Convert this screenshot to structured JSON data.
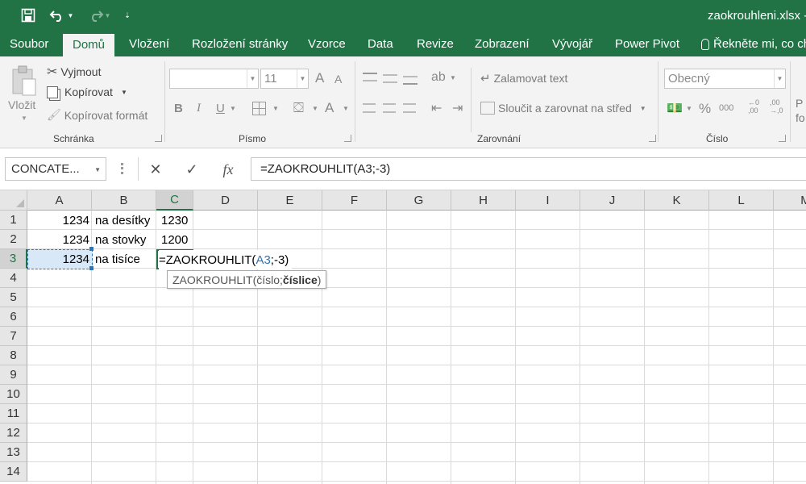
{
  "window": {
    "title": "zaokrouhleni.xlsx -"
  },
  "qat": {
    "save_icon": "save-icon",
    "undo_icon": "undo-icon",
    "redo_icon": "redo-icon",
    "customize_icon": "chevron-down-icon"
  },
  "tabs": [
    {
      "label": "Soubor"
    },
    {
      "label": "Domů"
    },
    {
      "label": "Vložení"
    },
    {
      "label": "Rozložení stránky"
    },
    {
      "label": "Vzorce"
    },
    {
      "label": "Data"
    },
    {
      "label": "Revize"
    },
    {
      "label": "Zobrazení"
    },
    {
      "label": "Vývojář"
    },
    {
      "label": "Power Pivot"
    },
    {
      "label": "Řekněte mi, co ch"
    }
  ],
  "ribbon": {
    "clipboard": {
      "paste": "Vložit",
      "cut": "Vyjmout",
      "copy": "Kopírovat",
      "format_painter": "Kopírovat formát",
      "group": "Schránka"
    },
    "font": {
      "font_name": "",
      "font_size": "11",
      "group": "Písmo",
      "bold": "B",
      "italic": "I",
      "underline": "U",
      "grow": "A",
      "shrink": "A",
      "font_color": "A"
    },
    "alignment": {
      "wrap": "Zalamovat text",
      "merge": "Sloučit a zarovnat na střed",
      "group": "Zarovnání"
    },
    "number": {
      "format": "Obecný",
      "percent": "%",
      "thousands": "000",
      "group": "Číslo",
      "inc_decimal": "←0 ,00",
      "dec_decimal": ",00 →,0"
    },
    "cut_right": {
      "line1": "P",
      "line2": "fo"
    }
  },
  "formula_bar": {
    "name_box": "CONCATE...",
    "cancel": "✕",
    "enter": "✓",
    "fx": "fx",
    "formula": "=ZAOKROUHLIT(A3;-3)"
  },
  "columns": [
    "A",
    "B",
    "C",
    "D",
    "E",
    "F",
    "G",
    "H",
    "I",
    "J",
    "K",
    "L",
    "M"
  ],
  "rows": [
    "1",
    "2",
    "3",
    "4",
    "5",
    "6",
    "7",
    "8",
    "9",
    "10",
    "11",
    "12",
    "13",
    "14"
  ],
  "cells": {
    "A1": "1234",
    "B1": "na desítky",
    "C1": "1230",
    "A2": "1234",
    "B2": "na stovky",
    "C2": "1200",
    "A3": "1234",
    "B3": "na tisíce"
  },
  "edit": {
    "prefix": "=ZAOKROUHLIT(",
    "ref": "A3",
    "suffix": ";-3)"
  },
  "tooltip": {
    "func": "ZAOKROUHLIT(",
    "arg1": "číslo; ",
    "arg2": "číslice",
    "close": ")"
  },
  "colors": {
    "accent": "#217346",
    "ref": "#2e75b6"
  }
}
